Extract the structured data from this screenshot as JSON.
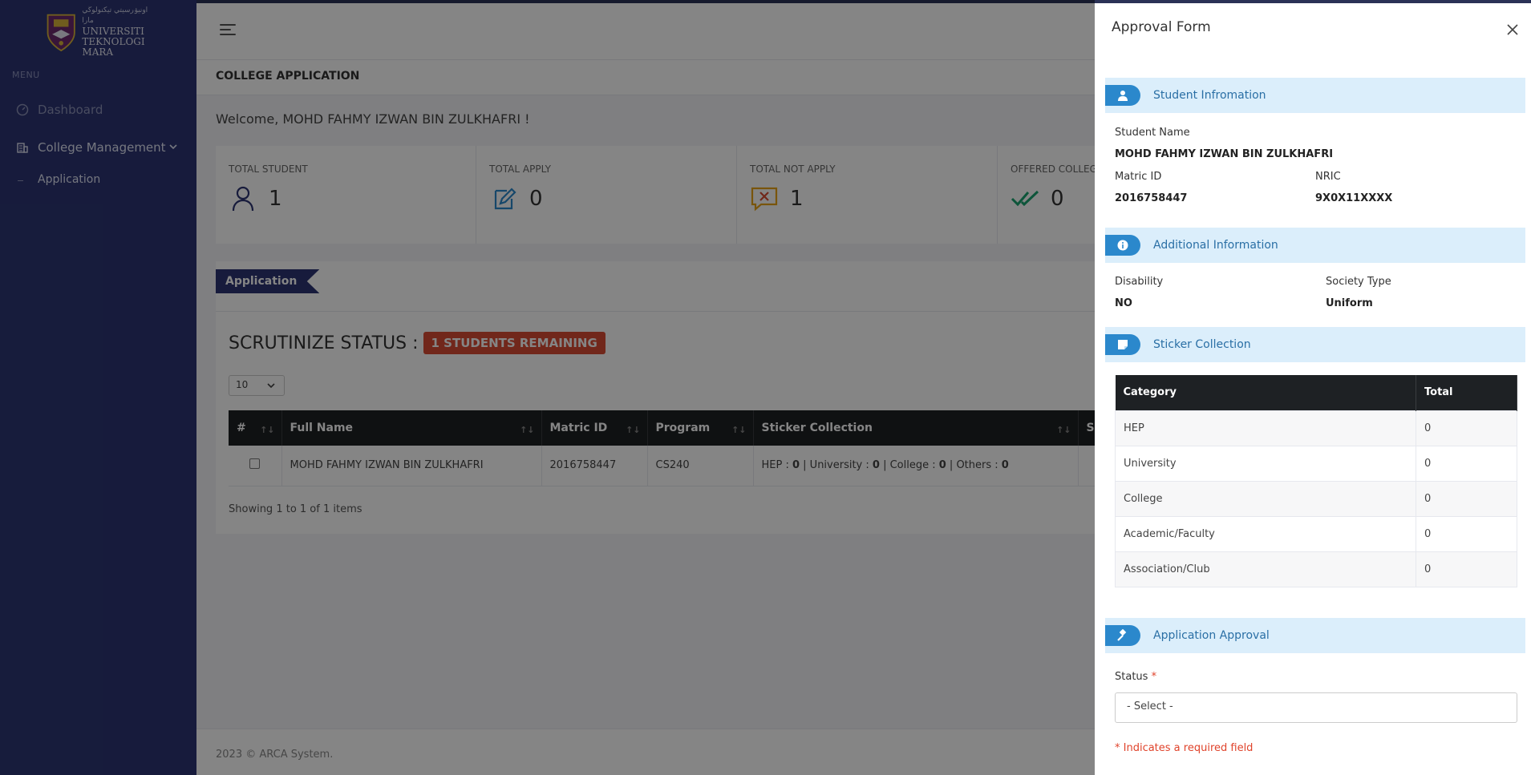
{
  "sidebar": {
    "logo": {
      "line1": "UNIVERSITI",
      "line2": "TEKNOLOGI",
      "line3": "MARA",
      "arabic": "اونيۏرسيتي تيكنولوڬي مارا"
    },
    "menu_heading": "MENU",
    "items": [
      {
        "label": "Dashboard",
        "icon": "dashboard-icon"
      },
      {
        "label": "College Management",
        "icon": "building-icon"
      }
    ],
    "sub_items": [
      {
        "label": "Application"
      }
    ]
  },
  "header": {
    "page_title": "COLLEGE APPLICATION",
    "welcome": "Welcome, MOHD FAHMY IZWAN BIN ZULKHAFRI !"
  },
  "stats": [
    {
      "label": "TOTAL STUDENT",
      "value": "1",
      "icon": "user-icon",
      "color": "#2c3573"
    },
    {
      "label": "TOTAL APPLY",
      "value": "0",
      "icon": "edit-icon",
      "color": "#2b88cc"
    },
    {
      "label": "TOTAL NOT APPLY",
      "value": "1",
      "icon": "message-x-icon",
      "color": "#e8a317"
    },
    {
      "label": "OFFERED COLLEGE",
      "value": "0",
      "icon": "double-check-icon",
      "color": "#1aa36f"
    }
  ],
  "application": {
    "tab_label": "Application",
    "scrutinize_label": "SCRUTINIZE STATUS :",
    "remaining_badge": "1 STUDENTS REMAINING",
    "page_size": "10",
    "columns": [
      "#",
      "Full Name",
      "Matric ID",
      "Program",
      "Sticker Collection",
      "S"
    ],
    "rows": [
      {
        "name": "MOHD FAHMY IZWAN BIN ZULKHAFRI",
        "matric": "2016758447",
        "program": "CS240",
        "sticker": {
          "hep_label": "HEP : ",
          "hep": "0",
          "uni_label": " | University : ",
          "uni": "0",
          "col_label": " | College : ",
          "col": "0",
          "oth_label": " | Others : ",
          "oth": "0"
        }
      }
    ],
    "showing": "Showing 1 to 1 of 1 items"
  },
  "footer": {
    "text": "2023 © ARCA System."
  },
  "panel": {
    "title": "Approval Form",
    "student_section": "Student Infromation",
    "student_name_label": "Student Name",
    "student_name": "MOHD FAHMY IZWAN BIN ZULKHAFRI",
    "matric_label": "Matric ID",
    "matric": "2016758447",
    "nric_label": "NRIC",
    "nric": "9X0X11XXXX",
    "additional_section": "Additional Information",
    "disability_label": "Disability",
    "disability": "NO",
    "society_label": "Society Type",
    "society": "Uniform",
    "sticker_section": "Sticker Collection",
    "sticker_columns": [
      "Category",
      "Total"
    ],
    "sticker_rows": [
      {
        "category": "HEP",
        "total": "0"
      },
      {
        "category": "University",
        "total": "0"
      },
      {
        "category": "College",
        "total": "0"
      },
      {
        "category": "Academic/Faculty",
        "total": "0"
      },
      {
        "category": "Association/Club",
        "total": "0"
      }
    ],
    "approval_section": "Application Approval",
    "status_label": "Status",
    "required_mark": "*",
    "status_value": "- Select -",
    "required_note": "* Indicates a required field"
  }
}
